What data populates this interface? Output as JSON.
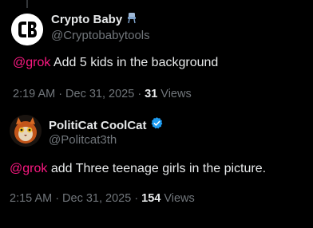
{
  "colors": {
    "background": "#000000",
    "text_primary": "#e7e9ea",
    "text_secondary": "#71767b",
    "mention": "#f91880",
    "verified": "#1d9bf0"
  },
  "posts": [
    {
      "display_name": "Crypto Baby",
      "name_emoji_icon": "baby-chair-icon",
      "handle": "@Cryptobabytools",
      "mention": "@grok",
      "text": " Add 5 kids in the background",
      "time": "2:19 AM",
      "separator": "·",
      "date": "Dec 31, 2025",
      "views_count": "31",
      "views_label": "Views"
    },
    {
      "display_name": "PolitiCat CoolCat",
      "verified_icon": "verified-badge-icon",
      "handle": "@Politcat3th",
      "mention": "@grok",
      "text": " add Three teenage girls in the picture.",
      "time": "2:15 AM",
      "separator": "·",
      "date": "Dec 31, 2025",
      "views_count": "154",
      "views_label": "Views"
    }
  ]
}
